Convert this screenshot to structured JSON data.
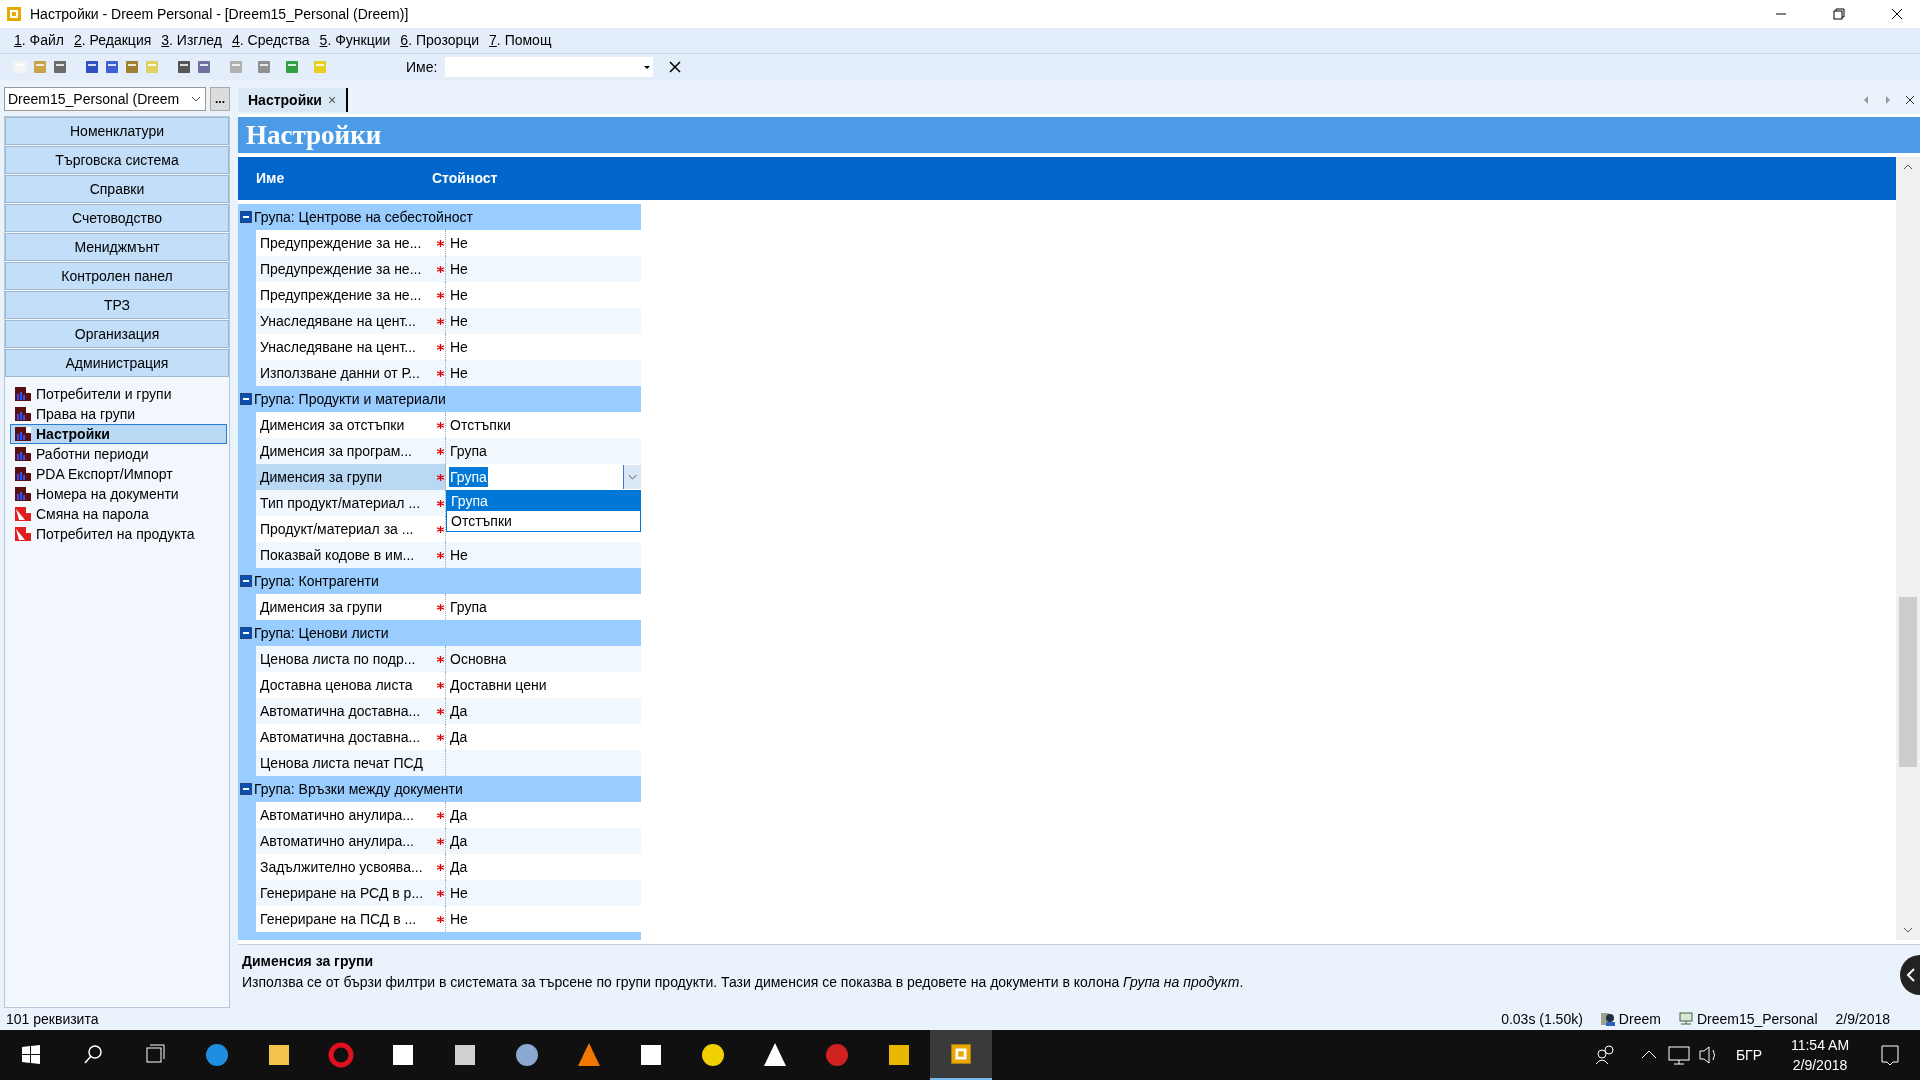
{
  "window": {
    "title": "Настройки - Dreem Personal - [Dreem15_Personal (Dreem)]"
  },
  "menu": [
    {
      "key": "1",
      "label": ". Файл"
    },
    {
      "key": "2",
      "label": ". Редакция"
    },
    {
      "key": "3",
      "label": ". Изглед"
    },
    {
      "key": "4",
      "label": ". Средства"
    },
    {
      "key": "5",
      "label": ". Функции"
    },
    {
      "key": "6",
      "label": ". Прозорци"
    },
    {
      "key": "7",
      "label": ". Помощ"
    }
  ],
  "toolbar": {
    "name_label": "Име:"
  },
  "database_selector": {
    "value": "Dreem15_Personal (Dreem",
    "button": "..."
  },
  "tabs": [
    {
      "label": "Настройки",
      "selected": true,
      "close": "×"
    }
  ],
  "nav_sections": [
    "Номенклатури",
    "Търговска система",
    "Справки",
    "Счетоводство",
    "Мениджмънт",
    "Контролен панел",
    "ТРЗ",
    "Организация",
    "Администрация"
  ],
  "tree": [
    {
      "label": "Потребители и групи",
      "kind": "list",
      "selected": false
    },
    {
      "label": "Права на групи",
      "kind": "list",
      "selected": false
    },
    {
      "label": "Настройки",
      "kind": "list",
      "selected": true
    },
    {
      "label": "Работни периоди",
      "kind": "list",
      "selected": false
    },
    {
      "label": "PDA Експорт/Импорт",
      "kind": "list",
      "selected": false
    },
    {
      "label": "Номера на документи",
      "kind": "list",
      "selected": false
    },
    {
      "label": "Смяна на парола",
      "kind": "form",
      "selected": false
    },
    {
      "label": "Потребител на продукта",
      "kind": "form",
      "selected": false
    }
  ],
  "page_title": "Настройки",
  "grid": {
    "columns": [
      "Име",
      "Стойност"
    ],
    "groups": [
      {
        "title": "Група: Центрове на себестойност",
        "expanded": true,
        "rows": [
          {
            "name": "Предупреждение за не...",
            "required": true,
            "value": "Не",
            "selected": false
          },
          {
            "name": "Предупреждение за не...",
            "required": true,
            "value": "Не",
            "selected": false
          },
          {
            "name": "Предупреждение за не...",
            "required": true,
            "value": "Не",
            "selected": false
          },
          {
            "name": "Унаследяване на цент...",
            "required": true,
            "value": "Не",
            "selected": false
          },
          {
            "name": "Унаследяване на цент...",
            "required": true,
            "value": "Не",
            "selected": false
          },
          {
            "name": "Използване данни от Р...",
            "required": true,
            "value": "Не",
            "selected": false
          }
        ]
      },
      {
        "title": "Група: Продукти и материали",
        "expanded": true,
        "rows": [
          {
            "name": "Дименсия за отстъпки",
            "required": true,
            "value": "Отстъпки",
            "selected": false
          },
          {
            "name": "Дименсия за програм...",
            "required": true,
            "value": "Група",
            "selected": false
          },
          {
            "name": "Дименсия за групи",
            "required": true,
            "value": "Група",
            "selected": true
          },
          {
            "name": "Тип продукт/материал ...",
            "required": true,
            "selected": false
          },
          {
            "name": "Продукт/материал за ...",
            "required": true,
            "selected": false
          },
          {
            "name": "Показвай кодове в им...",
            "required": true,
            "value": "Не",
            "selected": false
          }
        ]
      },
      {
        "title": "Група: Контрагенти",
        "expanded": true,
        "rows": [
          {
            "name": "Дименсия за групи",
            "required": true,
            "value": "Група",
            "selected": false
          }
        ]
      },
      {
        "title": "Група: Ценови листи",
        "expanded": true,
        "rows": [
          {
            "name": "Ценова листа по подр...",
            "required": true,
            "value": "Основна",
            "selected": false
          },
          {
            "name": "Доставна ценова листа",
            "required": true,
            "value": "Доставни цени",
            "selected": false
          },
          {
            "name": "Автоматична доставна...",
            "required": true,
            "value": "Да",
            "selected": false
          },
          {
            "name": "Автоматична доставна...",
            "required": true,
            "value": "Да",
            "selected": false
          },
          {
            "name": "Ценова листа печат ПСД",
            "required": false,
            "selected": false
          }
        ]
      },
      {
        "title": "Група: Връзки между документи",
        "expanded": true,
        "rows": [
          {
            "name": "Автоматично анулира...",
            "required": true,
            "value": "Да",
            "selected": false
          },
          {
            "name": "Автоматично анулира...",
            "required": true,
            "value": "Да",
            "selected": false
          },
          {
            "name": "Задължително усвоява...",
            "required": true,
            "value": "Да",
            "selected": false
          },
          {
            "name": "Генериране на РСД в р...",
            "required": true,
            "value": "Не",
            "selected": false
          },
          {
            "name": "Генериране на ПСД в ...",
            "required": true,
            "value": "Не",
            "selected": false
          }
        ]
      }
    ],
    "dropdown": {
      "options": [
        {
          "label": "Група",
          "selected": true
        },
        {
          "label": "Отстъпки",
          "selected": false
        }
      ]
    }
  },
  "description": {
    "title": "Дименсия за групи",
    "text": "Използва се от бързи филтри в системата за търсене по групи продукти. Тази дименсия се показва в редовете на документи в колона *Група на продукт*."
  },
  "status_bar": {
    "count": "101 реквизита",
    "timing": "0.03s (1.50k)",
    "user": "Dreem",
    "database": "Dreem15_Personal",
    "date": "2/9/2018"
  },
  "taskbar": {
    "language": "БГР",
    "time": "11:54 AM",
    "date": "2/9/2018"
  }
}
